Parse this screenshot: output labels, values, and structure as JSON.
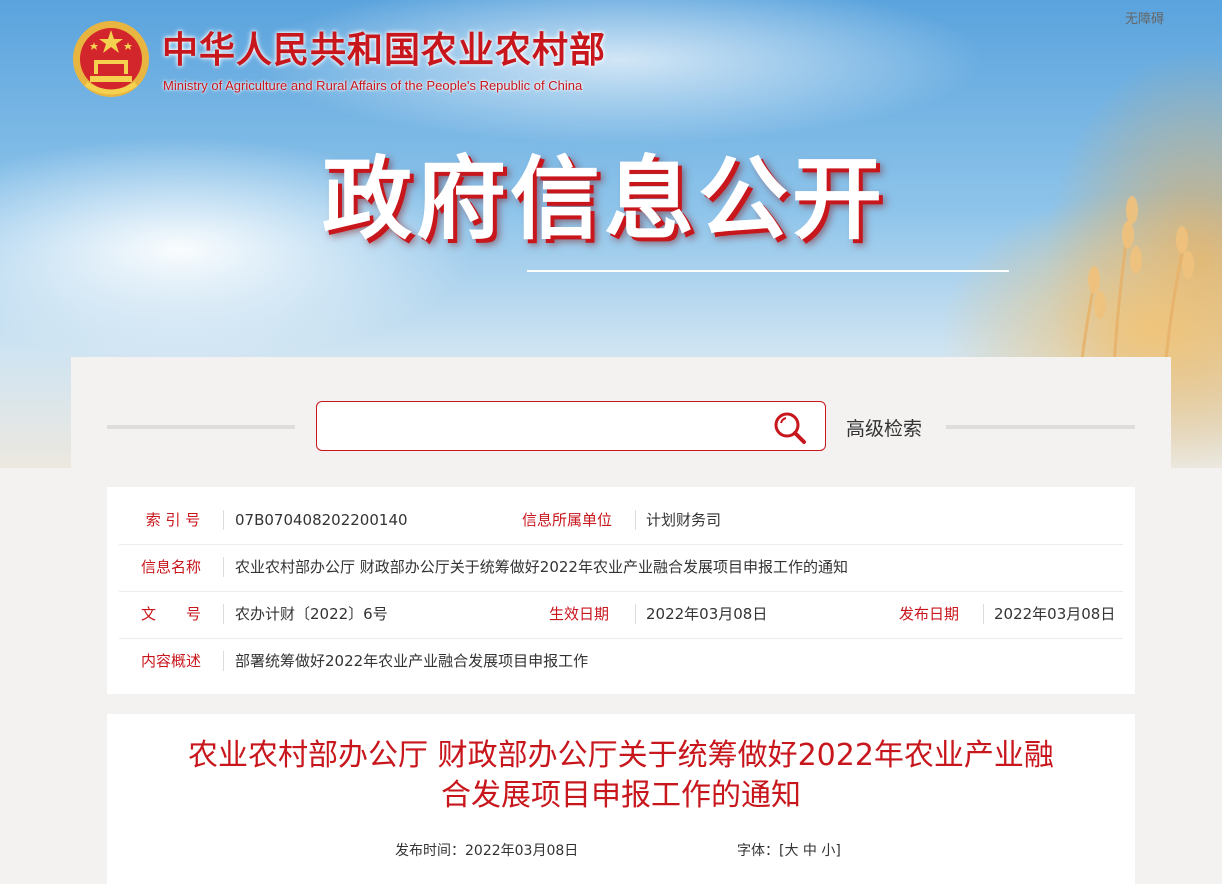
{
  "header": {
    "accessibility_label": "无障碍",
    "site_title": "中华人民共和国农业农村部",
    "site_subtitle": "Ministry of Agriculture and Rural Affairs of the People's Republic of China",
    "hero_title": "政府信息公开"
  },
  "search": {
    "value": "",
    "placeholder": "",
    "advanced_label": "高级检索"
  },
  "info": {
    "index_label": "索 引 号",
    "index_value": "07B070408202200140",
    "unit_label": "信息所属单位",
    "unit_value": "计划财务司",
    "name_label": "信息名称",
    "name_value": "农业农村部办公厅 财政部办公厅关于统筹做好2022年农业产业融合发展项目申报工作的通知",
    "doc_no_label": "文　　号",
    "doc_no_value": "农办计财〔2022〕6号",
    "effective_label": "生效日期",
    "effective_value": "2022年03月08日",
    "publish_label": "发布日期",
    "publish_value": "2022年03月08日",
    "summary_label": "内容概述",
    "summary_value": "部署统筹做好2022年农业产业融合发展项目申报工作"
  },
  "article": {
    "title_line1": "农业农村部办公厅 财政部办公厅关于统筹做好2022年农业产业融",
    "title_line2": "合发展项目申报工作的通知",
    "publish_time": "发布时间：2022年03月08日",
    "font_label": "字体：",
    "font_open": "[",
    "font_large": "大",
    "font_medium": "中",
    "font_small": "小",
    "font_close": "]"
  },
  "colors": {
    "accent": "#c8161d",
    "panel_bg": "#f3f2f1",
    "text": "#333333"
  },
  "icons": [
    "national-emblem-icon",
    "search-icon"
  ]
}
